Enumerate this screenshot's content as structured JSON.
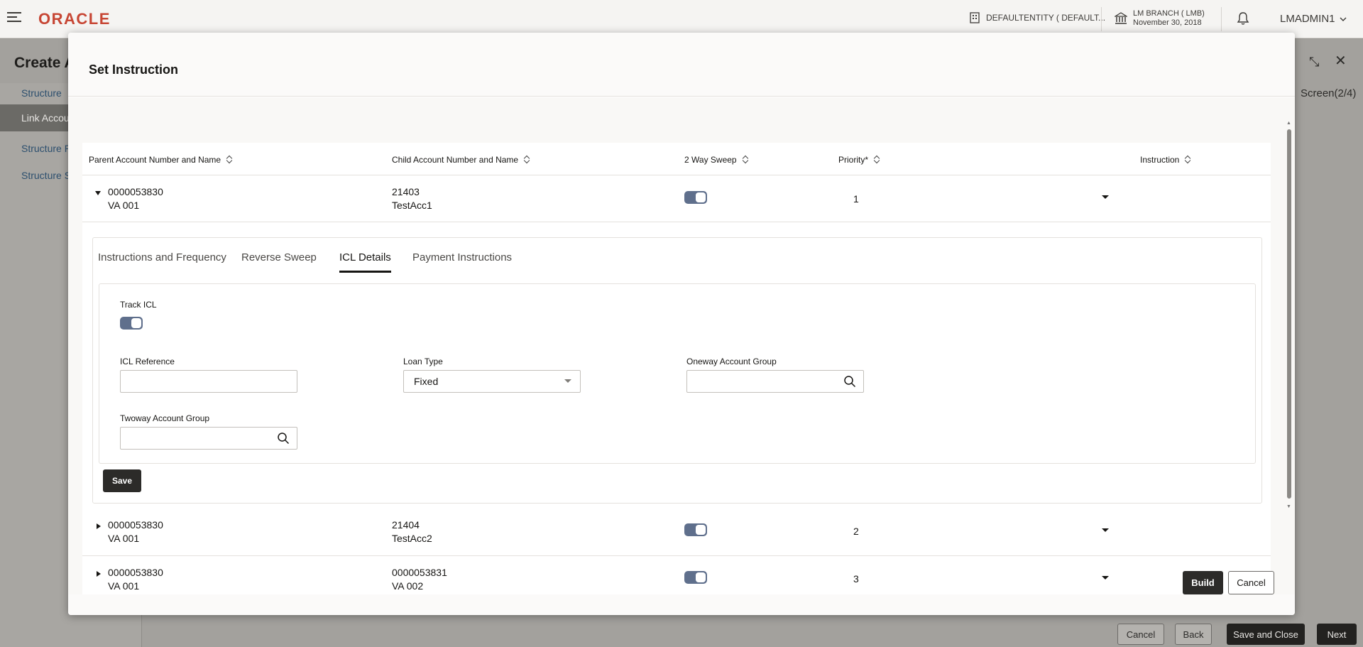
{
  "header": {
    "logo": "ORACLE",
    "entity": "DEFAULTENTITY ( DEFAULT...",
    "branch": "LM BRANCH ( LMB)",
    "branch_date": "November 30, 2018",
    "user": "LMADMIN1"
  },
  "background": {
    "page_title": "Create A",
    "steps": [
      "Structure",
      "Link Accou",
      "Structure P",
      "Structure S"
    ],
    "screen_indicator": "Screen(2/4)",
    "footer_buttons": {
      "cancel": "Cancel",
      "back": "Back",
      "save_close": "Save and Close",
      "next": "Next"
    }
  },
  "modal": {
    "title": "Set Instruction",
    "columns": [
      "Parent Account Number and Name",
      "Child Account Number and Name",
      "2 Way Sweep",
      "Priority*",
      "Instruction"
    ],
    "rows": [
      {
        "parent_no": "0000053830",
        "parent_name": "VA 001",
        "child_no": "21403",
        "child_name": "TestAcc1",
        "two_way": true,
        "priority": "1",
        "expanded": true
      },
      {
        "parent_no": "0000053830",
        "parent_name": "VA 001",
        "child_no": "21404",
        "child_name": "TestAcc2",
        "two_way": true,
        "priority": "2",
        "expanded": false
      },
      {
        "parent_no": "0000053830",
        "parent_name": "VA 001",
        "child_no": "0000053831",
        "child_name": "VA 002",
        "two_way": true,
        "priority": "3",
        "expanded": false
      }
    ],
    "tabs": [
      "Instructions and Frequency",
      "Reverse Sweep",
      "ICL Details",
      "Payment Instructions"
    ],
    "active_tab": "ICL Details",
    "icl": {
      "track_icl_label": "Track ICL",
      "track_icl_on": true,
      "icl_reference_label": "ICL Reference",
      "icl_reference_value": "",
      "loan_type_label": "Loan Type",
      "loan_type_value": "Fixed",
      "oneway_label": "Oneway Account Group",
      "oneway_value": "",
      "twoway_label": "Twoway Account Group",
      "twoway_value": ""
    },
    "save_label": "Save",
    "build_label": "Build",
    "cancel_label": "Cancel"
  },
  "colors": {
    "brand": "#c74634",
    "toggle_on": "#5f6f8c",
    "primary_button": "#2c2b29"
  },
  "icons": [
    "menu-icon",
    "entity-icon",
    "bank-icon",
    "bell-icon",
    "search-icon",
    "chevron-down-icon",
    "sort-icon",
    "collapse-icon",
    "close-icon"
  ]
}
